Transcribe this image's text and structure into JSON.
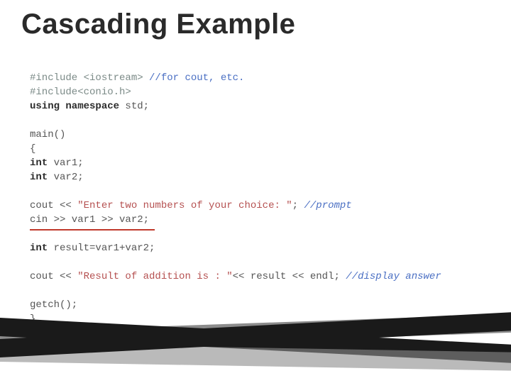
{
  "title": "Cascading Example",
  "code": {
    "l1_pp": "#include <iostream> ",
    "l1_cmt": "//for cout, etc.",
    "l2_pp": "#include<conio.h>",
    "l3_kw1": "using namespace ",
    "l3_id": "std;",
    "l5_id": "main()",
    "l6": "{",
    "l7_kw": "int ",
    "l7_id": "var1;",
    "l8_kw": "int ",
    "l8_id": "var2;",
    "l10_a": "cout << ",
    "l10_str": "\"Enter two numbers of your choice: \"",
    "l10_b": "; ",
    "l10_cmt": "//prompt",
    "l11": "cin >> var1 >> var2;",
    "l13_kw": "int ",
    "l13_id": "result=var1+var2;",
    "l15_a": "cout << ",
    "l15_str": "\"Result of addition is : \"",
    "l15_b": "<< result << endl; ",
    "l15_cmt": "//display answer",
    "l17": "getch();",
    "l18": "}"
  }
}
